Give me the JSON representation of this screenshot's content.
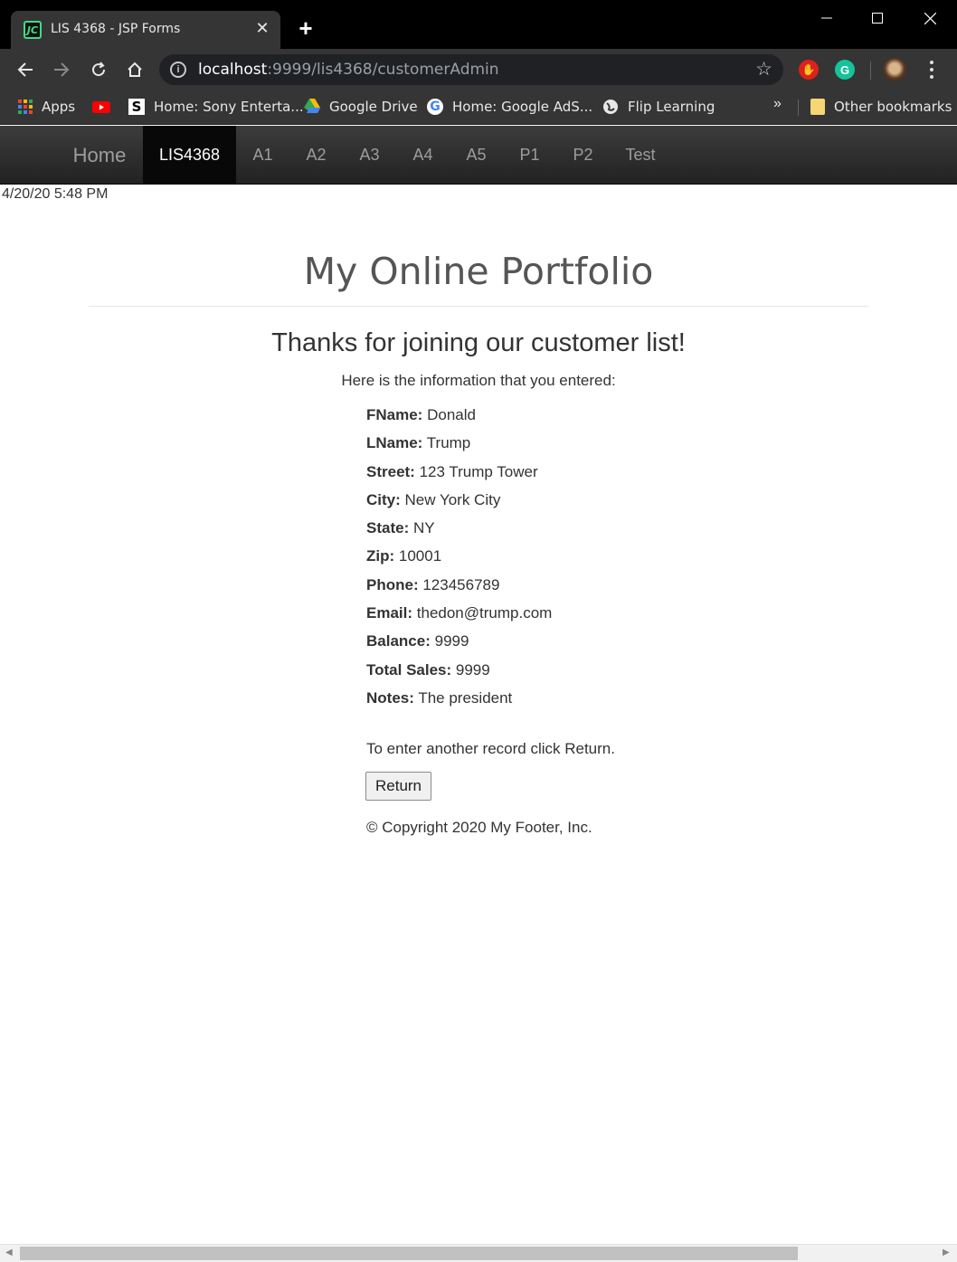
{
  "browser": {
    "tab_title": "LIS 4368 - JSP Forms",
    "favicon_text": "JC",
    "url_host": "localhost",
    "url_rest": ":9999/lis4368/customerAdmin",
    "bookmarks": [
      {
        "label": "Apps",
        "icon": "apps-grid-icon"
      },
      {
        "label": "",
        "icon": "youtube-icon"
      },
      {
        "label": "Home: Sony Enterta...",
        "icon": "sony-s-icon"
      },
      {
        "label": "Google Drive",
        "icon": "google-drive-icon"
      },
      {
        "label": "Home: Google AdS...",
        "icon": "google-g-icon"
      },
      {
        "label": "Flip Learning",
        "icon": "globe-icon"
      }
    ],
    "bookmarks_overflow": "»",
    "other_bookmarks": "Other bookmarks"
  },
  "navbar": {
    "brand": "Home",
    "items": [
      "LIS4368",
      "A1",
      "A2",
      "A3",
      "A4",
      "A5",
      "P1",
      "P2",
      "Test"
    ],
    "active": "LIS4368"
  },
  "page": {
    "datetime": "4/20/20 5:48 PM",
    "title": "My Online Portfolio",
    "heading": "Thanks for joining our customer list!",
    "intro": "Here is the information that you entered:",
    "fields": [
      {
        "label": "FName:",
        "value": "Donald"
      },
      {
        "label": "LName:",
        "value": "Trump"
      },
      {
        "label": "Street:",
        "value": "123 Trump Tower"
      },
      {
        "label": "City:",
        "value": "New York City"
      },
      {
        "label": "State:",
        "value": "NY"
      },
      {
        "label": "Zip:",
        "value": "10001"
      },
      {
        "label": "Phone:",
        "value": "123456789"
      },
      {
        "label": "Email:",
        "value": "thedon@trump.com"
      },
      {
        "label": "Balance:",
        "value": "9999"
      },
      {
        "label": "Total Sales:",
        "value": "9999"
      },
      {
        "label": "Notes:",
        "value": "The president"
      }
    ],
    "another_record": "To enter another record click Return.",
    "return_button": "Return",
    "copyright": "© Copyright 2020 My Footer, Inc."
  },
  "colors": {
    "navbar_bg": "#222222",
    "navbar_active": "#080808",
    "chrome_bg": "#353535"
  }
}
